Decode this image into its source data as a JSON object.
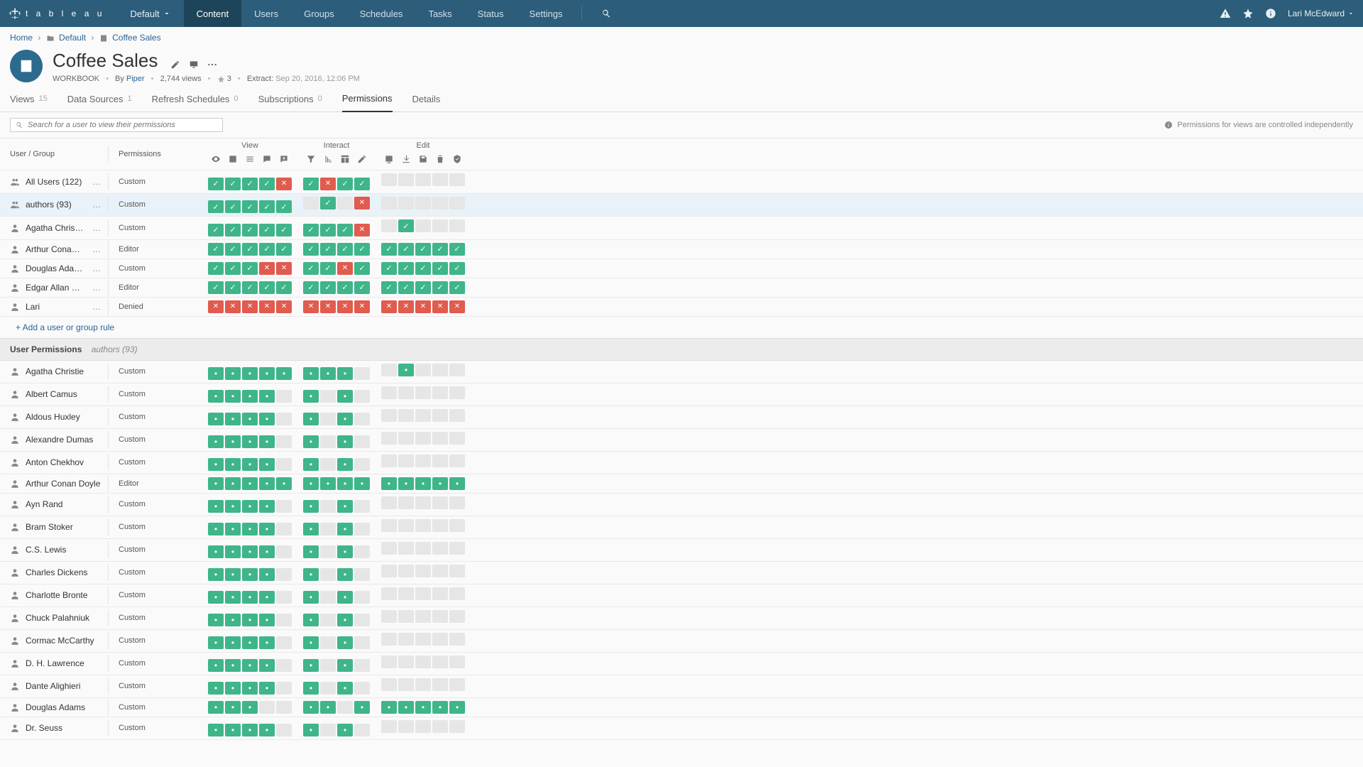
{
  "nav": {
    "logo_text": "t a b l e a u",
    "site_label": "Default",
    "items": [
      "Content",
      "Users",
      "Groups",
      "Schedules",
      "Tasks",
      "Status",
      "Settings"
    ],
    "active_index": 0,
    "user": "Lari McEdward"
  },
  "breadcrumb": {
    "home": "Home",
    "folder": "Default",
    "item": "Coffee Sales"
  },
  "header": {
    "title": "Coffee Sales",
    "type_label": "WORKBOOK",
    "by_label": "By",
    "owner": "Piper",
    "views_text": "2,744 views",
    "star_count": "3",
    "extract_label": "Extract",
    "extract_time": "Sep 20, 2016, 12:06 PM"
  },
  "tabs": [
    {
      "label": "Views",
      "count": "15"
    },
    {
      "label": "Data Sources",
      "count": "1"
    },
    {
      "label": "Refresh Schedules",
      "count": "0"
    },
    {
      "label": "Subscriptions",
      "count": "0"
    },
    {
      "label": "Permissions",
      "count": ""
    },
    {
      "label": "Details",
      "count": ""
    }
  ],
  "active_tab": 4,
  "search": {
    "placeholder": "Search for a user to view their permissions"
  },
  "hint": "Permissions for views are controlled independently",
  "columns": {
    "user_group": "User / Group",
    "permissions": "Permissions",
    "groups": [
      "View",
      "Interact",
      "Edit"
    ]
  },
  "cap_icons": {
    "view": [
      "eye",
      "image",
      "list",
      "comment",
      "comment-add"
    ],
    "interact": [
      "filter",
      "sort",
      "web-edit",
      "pencil"
    ],
    "edit": [
      "download",
      "download-data",
      "save-as",
      "delete",
      "perm"
    ]
  },
  "rules": [
    {
      "icon": "group",
      "name": "All Users (122)",
      "perm": "Custom",
      "view": [
        "A",
        "A",
        "A",
        "A",
        "D"
      ],
      "interact": [
        "A",
        "D",
        "A",
        "A"
      ],
      "edit": [
        "U",
        "U",
        "U",
        "U",
        "U"
      ]
    },
    {
      "icon": "group",
      "name": "authors (93)",
      "perm": "Custom",
      "selected": true,
      "view": [
        "A",
        "A",
        "A",
        "A",
        "A"
      ],
      "interact": [
        "U",
        "A",
        "U",
        "D"
      ],
      "edit": [
        "U",
        "U",
        "U",
        "U",
        "U"
      ]
    },
    {
      "icon": "user",
      "name": "Agatha Christie",
      "perm": "Custom",
      "view": [
        "A",
        "A",
        "A",
        "A",
        "A"
      ],
      "interact": [
        "A",
        "A",
        "A",
        "D"
      ],
      "edit": [
        "U",
        "A",
        "U",
        "U",
        "U"
      ]
    },
    {
      "icon": "user",
      "name": "Arthur Conan Doyle",
      "perm": "Editor",
      "view": [
        "A",
        "A",
        "A",
        "A",
        "A"
      ],
      "interact": [
        "A",
        "A",
        "A",
        "A"
      ],
      "edit": [
        "A",
        "A",
        "A",
        "A",
        "A"
      ]
    },
    {
      "icon": "user",
      "name": "Douglas Adams",
      "perm": "Custom",
      "view": [
        "A",
        "A",
        "A",
        "D",
        "D"
      ],
      "interact": [
        "A",
        "A",
        "D",
        "A"
      ],
      "edit": [
        "A",
        "A",
        "A",
        "A",
        "A"
      ]
    },
    {
      "icon": "user",
      "name": "Edgar Allan Poe",
      "perm": "Editor",
      "view": [
        "A",
        "A",
        "A",
        "A",
        "A"
      ],
      "interact": [
        "A",
        "A",
        "A",
        "A"
      ],
      "edit": [
        "A",
        "A",
        "A",
        "A",
        "A"
      ]
    },
    {
      "icon": "user",
      "name": "Lari",
      "perm": "Denied",
      "view": [
        "D",
        "D",
        "D",
        "D",
        "D"
      ],
      "interact": [
        "D",
        "D",
        "D",
        "D"
      ],
      "edit": [
        "D",
        "D",
        "D",
        "D",
        "D"
      ]
    }
  ],
  "add_rule": "+ Add a user or group rule",
  "user_perms_header": {
    "title": "User Permissions",
    "context": "authors (93)"
  },
  "user_rows": [
    {
      "name": "Agatha Christie",
      "perm": "Custom",
      "view": [
        "a",
        "a",
        "a",
        "a",
        "a"
      ],
      "interact": [
        "a",
        "a",
        "a",
        "u"
      ],
      "edit": [
        "u",
        "a",
        "u",
        "u",
        "u"
      ]
    },
    {
      "name": "Albert Camus",
      "perm": "Custom",
      "view": [
        "a",
        "a",
        "a",
        "a",
        "u"
      ],
      "interact": [
        "a",
        "u",
        "a",
        "u"
      ],
      "edit": [
        "u",
        "u",
        "u",
        "u",
        "u"
      ]
    },
    {
      "name": "Aldous Huxley",
      "perm": "Custom",
      "view": [
        "a",
        "a",
        "a",
        "a",
        "u"
      ],
      "interact": [
        "a",
        "u",
        "a",
        "u"
      ],
      "edit": [
        "u",
        "u",
        "u",
        "u",
        "u"
      ]
    },
    {
      "name": "Alexandre Dumas",
      "perm": "Custom",
      "view": [
        "a",
        "a",
        "a",
        "a",
        "u"
      ],
      "interact": [
        "a",
        "u",
        "a",
        "u"
      ],
      "edit": [
        "u",
        "u",
        "u",
        "u",
        "u"
      ]
    },
    {
      "name": "Anton Chekhov",
      "perm": "Custom",
      "view": [
        "a",
        "a",
        "a",
        "a",
        "u"
      ],
      "interact": [
        "a",
        "u",
        "a",
        "u"
      ],
      "edit": [
        "u",
        "u",
        "u",
        "u",
        "u"
      ]
    },
    {
      "name": "Arthur Conan Doyle",
      "perm": "Editor",
      "view": [
        "a",
        "a",
        "a",
        "a",
        "a"
      ],
      "interact": [
        "a",
        "a",
        "a",
        "a"
      ],
      "edit": [
        "a",
        "a",
        "a",
        "a",
        "a"
      ]
    },
    {
      "name": "Ayn Rand",
      "perm": "Custom",
      "view": [
        "a",
        "a",
        "a",
        "a",
        "u"
      ],
      "interact": [
        "a",
        "u",
        "a",
        "u"
      ],
      "edit": [
        "u",
        "u",
        "u",
        "u",
        "u"
      ]
    },
    {
      "name": "Bram Stoker",
      "perm": "Custom",
      "view": [
        "a",
        "a",
        "a",
        "a",
        "u"
      ],
      "interact": [
        "a",
        "u",
        "a",
        "u"
      ],
      "edit": [
        "u",
        "u",
        "u",
        "u",
        "u"
      ]
    },
    {
      "name": "C.S. Lewis",
      "perm": "Custom",
      "view": [
        "a",
        "a",
        "a",
        "a",
        "u"
      ],
      "interact": [
        "a",
        "u",
        "a",
        "u"
      ],
      "edit": [
        "u",
        "u",
        "u",
        "u",
        "u"
      ]
    },
    {
      "name": "Charles Dickens",
      "perm": "Custom",
      "view": [
        "a",
        "a",
        "a",
        "a",
        "u"
      ],
      "interact": [
        "a",
        "u",
        "a",
        "u"
      ],
      "edit": [
        "u",
        "u",
        "u",
        "u",
        "u"
      ]
    },
    {
      "name": "Charlotte Bronte",
      "perm": "Custom",
      "view": [
        "a",
        "a",
        "a",
        "a",
        "u"
      ],
      "interact": [
        "a",
        "u",
        "a",
        "u"
      ],
      "edit": [
        "u",
        "u",
        "u",
        "u",
        "u"
      ]
    },
    {
      "name": "Chuck Palahniuk",
      "perm": "Custom",
      "view": [
        "a",
        "a",
        "a",
        "a",
        "u"
      ],
      "interact": [
        "a",
        "u",
        "a",
        "u"
      ],
      "edit": [
        "u",
        "u",
        "u",
        "u",
        "u"
      ]
    },
    {
      "name": "Cormac McCarthy",
      "perm": "Custom",
      "view": [
        "a",
        "a",
        "a",
        "a",
        "u"
      ],
      "interact": [
        "a",
        "u",
        "a",
        "u"
      ],
      "edit": [
        "u",
        "u",
        "u",
        "u",
        "u"
      ]
    },
    {
      "name": "D. H. Lawrence",
      "perm": "Custom",
      "view": [
        "a",
        "a",
        "a",
        "a",
        "u"
      ],
      "interact": [
        "a",
        "u",
        "a",
        "u"
      ],
      "edit": [
        "u",
        "u",
        "u",
        "u",
        "u"
      ]
    },
    {
      "name": "Dante Alighieri",
      "perm": "Custom",
      "view": [
        "a",
        "a",
        "a",
        "a",
        "u"
      ],
      "interact": [
        "a",
        "u",
        "a",
        "u"
      ],
      "edit": [
        "u",
        "u",
        "u",
        "u",
        "u"
      ]
    },
    {
      "name": "Douglas Adams",
      "perm": "Custom",
      "view": [
        "a",
        "a",
        "a",
        "u",
        "u"
      ],
      "interact": [
        "a",
        "a",
        "u",
        "a"
      ],
      "edit": [
        "a",
        "a",
        "a",
        "a",
        "a"
      ]
    },
    {
      "name": "Dr. Seuss",
      "perm": "Custom",
      "view": [
        "a",
        "a",
        "a",
        "a",
        "u"
      ],
      "interact": [
        "a",
        "u",
        "a",
        "u"
      ],
      "edit": [
        "u",
        "u",
        "u",
        "u",
        "u"
      ]
    }
  ]
}
